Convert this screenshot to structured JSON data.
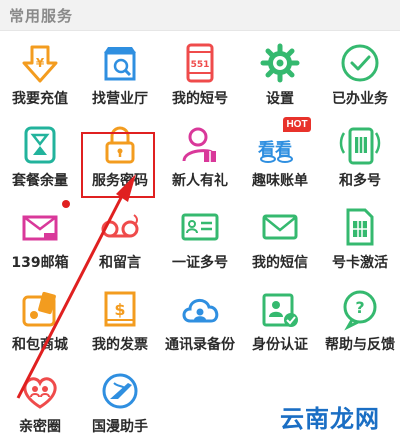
{
  "header": {
    "title": "常用服务"
  },
  "badges": {
    "hot": "HOT"
  },
  "watermark": "云南龙网",
  "colors": {
    "orange": "#f39c1f",
    "blue": "#2f8fe0",
    "red": "#ef4b4b",
    "green": "#35b96f",
    "magenta": "#d9389a",
    "teal": "#22b39c",
    "annotation": "#e02020"
  },
  "services": [
    {
      "label": "我要充值",
      "icon": "yuan-arrow-icon"
    },
    {
      "label": "找营业厅",
      "icon": "store-search-icon"
    },
    {
      "label": "我的短号",
      "icon": "phone-551-icon"
    },
    {
      "label": "设置",
      "icon": "gear-icon"
    },
    {
      "label": "已办业务",
      "icon": "check-circle-icon"
    },
    {
      "label": "套餐余量",
      "icon": "hourglass-icon"
    },
    {
      "label": "服务密码",
      "icon": "lock-icon"
    },
    {
      "label": "新人有礼",
      "icon": "person-gift-icon"
    },
    {
      "label": "趣味账单",
      "icon": "fun-bill-icon"
    },
    {
      "label": "和多号",
      "icon": "multi-sim-phone-icon"
    },
    {
      "label": "139邮箱",
      "icon": "mail-139-icon"
    },
    {
      "label": "和留言",
      "icon": "voicemail-icon"
    },
    {
      "label": "一证多号",
      "icon": "id-card-icon"
    },
    {
      "label": "我的短信",
      "icon": "envelope-icon"
    },
    {
      "label": "号卡激活",
      "icon": "sim-card-icon"
    },
    {
      "label": "和包商城",
      "icon": "wallet-shop-icon"
    },
    {
      "label": "我的发票",
      "icon": "invoice-icon"
    },
    {
      "label": "通讯录备份",
      "icon": "cloud-contacts-icon"
    },
    {
      "label": "身份认证",
      "icon": "id-verify-icon"
    },
    {
      "label": "帮助与反馈",
      "icon": "help-bubble-icon"
    },
    {
      "label": "亲密圈",
      "icon": "heart-people-icon"
    },
    {
      "label": "国漫助手",
      "icon": "globe-plane-icon"
    }
  ]
}
